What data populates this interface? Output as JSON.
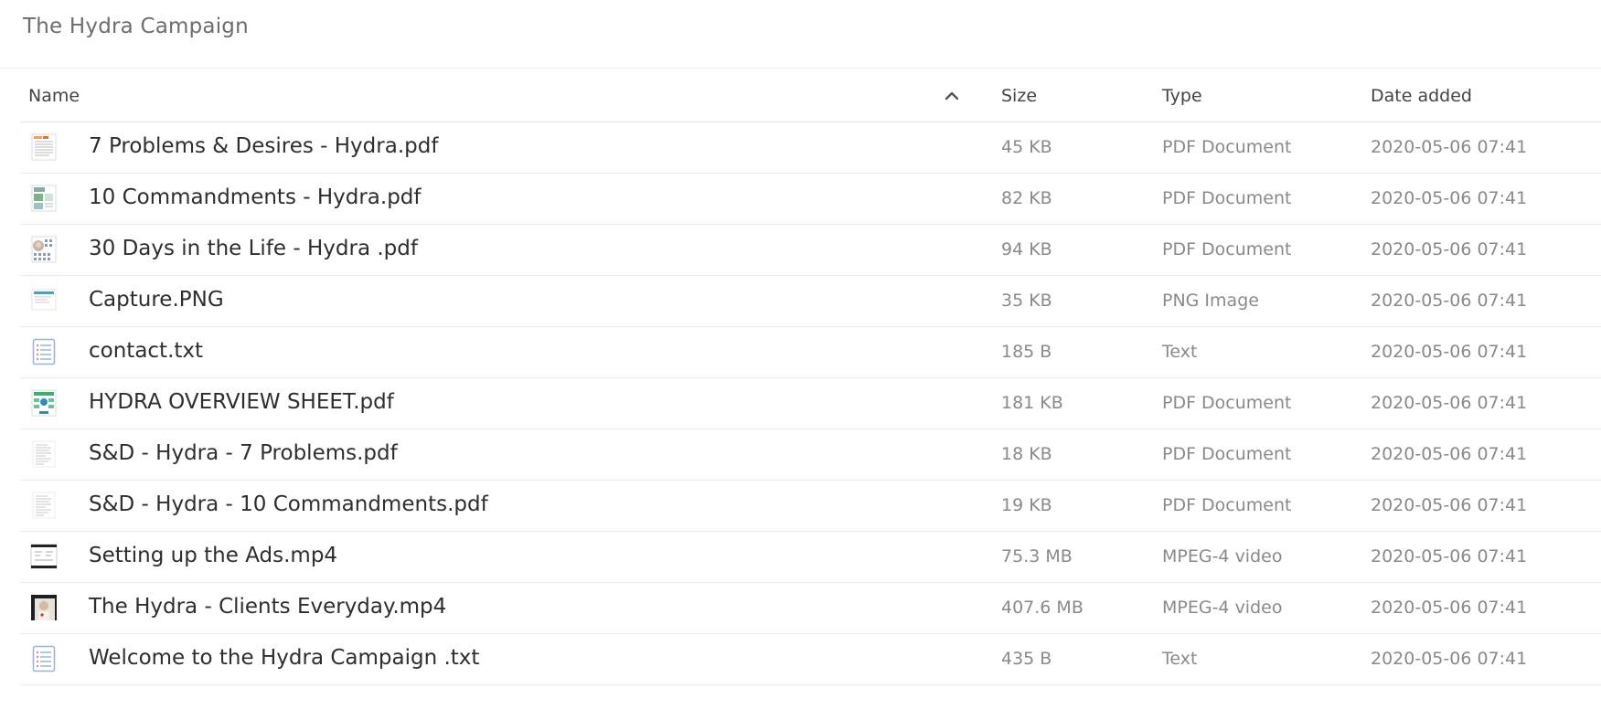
{
  "folder": {
    "title": "The Hydra Campaign"
  },
  "columns": {
    "name": "Name",
    "size": "Size",
    "type": "Type",
    "date": "Date added"
  },
  "sort": {
    "column": "Name",
    "direction": "ascending",
    "icon": "chevron-up-icon"
  },
  "files": [
    {
      "name": "7 Problems & Desires - Hydra.pdf",
      "size": "45 KB",
      "type": "PDF Document",
      "date": "2020-05-06 07:41",
      "thumb": "pdf-doc-orange"
    },
    {
      "name": "10 Commandments - Hydra.pdf",
      "size": "82 KB",
      "type": "PDF Document",
      "date": "2020-05-06 07:41",
      "thumb": "pdf-doc-green"
    },
    {
      "name": "30 Days in the Life - Hydra .pdf",
      "size": "94 KB",
      "type": "PDF Document",
      "date": "2020-05-06 07:41",
      "thumb": "pdf-calendar"
    },
    {
      "name": "Capture.PNG",
      "size": "35 KB",
      "type": "PNG Image",
      "date": "2020-05-06 07:41",
      "thumb": "png-screenshot"
    },
    {
      "name": "contact.txt",
      "size": "185 B",
      "type": "Text",
      "date": "2020-05-06 07:41",
      "thumb": "text-file-icon"
    },
    {
      "name": "HYDRA OVERVIEW SHEET.pdf",
      "size": "181 KB",
      "type": "PDF Document",
      "date": "2020-05-06 07:41",
      "thumb": "pdf-diagram"
    },
    {
      "name": "S&D - Hydra - 7 Problems.pdf",
      "size": "18 KB",
      "type": "PDF Document",
      "date": "2020-05-06 07:41",
      "thumb": "pdf-plain"
    },
    {
      "name": "S&D - Hydra - 10 Commandments.pdf",
      "size": "19 KB",
      "type": "PDF Document",
      "date": "2020-05-06 07:41",
      "thumb": "pdf-plain"
    },
    {
      "name": "Setting up the Ads.mp4",
      "size": "75.3 MB",
      "type": "MPEG-4 video",
      "date": "2020-05-06 07:41",
      "thumb": "video-screen"
    },
    {
      "name": "The Hydra - Clients Everyday.mp4",
      "size": "407.6 MB",
      "type": "MPEG-4 video",
      "date": "2020-05-06 07:41",
      "thumb": "video-person"
    },
    {
      "name": "Welcome to the Hydra Campaign .txt",
      "size": "435 B",
      "type": "Text",
      "date": "2020-05-06 07:41",
      "thumb": "text-file-icon"
    }
  ]
}
